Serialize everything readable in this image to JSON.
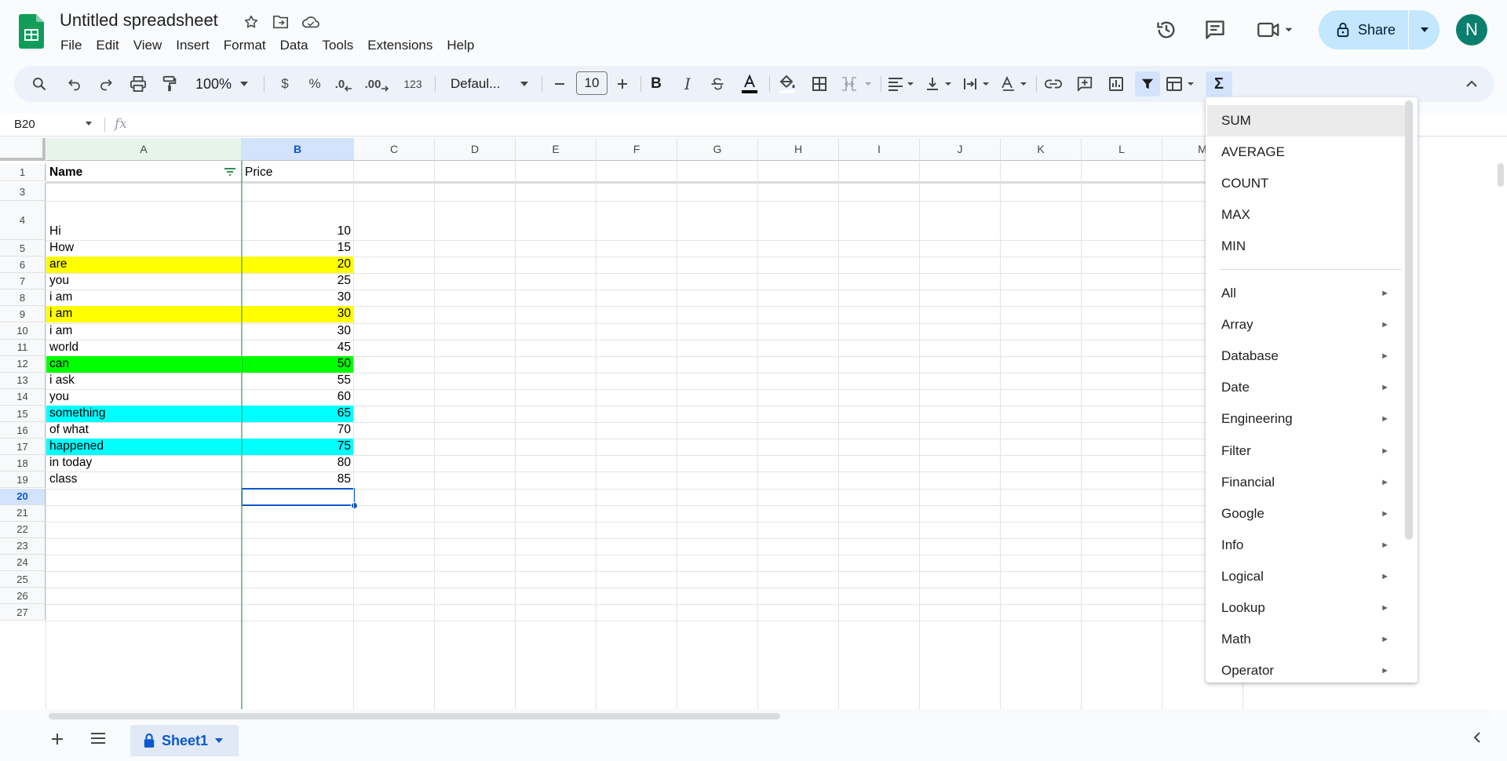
{
  "app": {
    "title": "Untitled spreadsheet",
    "menu": [
      "File",
      "Edit",
      "View",
      "Insert",
      "Format",
      "Data",
      "Tools",
      "Extensions",
      "Help"
    ],
    "share_label": "Share",
    "avatar_letter": "N",
    "accent": "#0b57d0",
    "share_bg": "#c2e7ff"
  },
  "toolbar": {
    "zoom": "100%",
    "currency": "$",
    "percent": "%",
    "dec_decrease": ".0",
    "dec_increase": ".00",
    "number_format": "123",
    "font": "Defaul...",
    "font_size": "10",
    "bold": "B",
    "italic": "I",
    "functions_symbol": "Σ"
  },
  "formula_bar": {
    "cell_ref": "B20",
    "fx": "fx"
  },
  "columns": [
    "A",
    "B",
    "C",
    "D",
    "E",
    "F",
    "G",
    "H",
    "I",
    "J",
    "K",
    "L",
    "M"
  ],
  "rows": [
    {
      "n": "1",
      "a": "Name",
      "b": "Price",
      "bold_a": true
    },
    {
      "n": "3",
      "a": "",
      "b": ""
    },
    {
      "n": "4",
      "a": "Hi",
      "b": "10"
    },
    {
      "n": "5",
      "a": "How",
      "b": "15"
    },
    {
      "n": "6",
      "a": "are",
      "b": "20",
      "fill": "#ffff00"
    },
    {
      "n": "7",
      "a": "you",
      "b": "25"
    },
    {
      "n": "8",
      "a": "i am",
      "b": "30"
    },
    {
      "n": "9",
      "a": "i am",
      "b": "30",
      "fill": "#ffff00"
    },
    {
      "n": "10",
      "a": "i am",
      "b": "30"
    },
    {
      "n": "11",
      "a": "world",
      "b": "45"
    },
    {
      "n": "12",
      "a": "can",
      "b": "50",
      "fill": "#00ff00"
    },
    {
      "n": "13",
      "a": "i ask",
      "b": "55"
    },
    {
      "n": "14",
      "a": "you",
      "b": "60"
    },
    {
      "n": "15",
      "a": "something",
      "b": "65",
      "fill": "#00ffff"
    },
    {
      "n": "16",
      "a": "of what",
      "b": "70"
    },
    {
      "n": "17",
      "a": "happened",
      "b": "75",
      "fill": "#00ffff"
    },
    {
      "n": "18",
      "a": "in today",
      "b": "80"
    },
    {
      "n": "19",
      "a": "class",
      "b": "85"
    },
    {
      "n": "20",
      "a": "",
      "b": ""
    },
    {
      "n": "21",
      "a": "",
      "b": ""
    },
    {
      "n": "22",
      "a": "",
      "b": ""
    },
    {
      "n": "23",
      "a": "",
      "b": ""
    },
    {
      "n": "24",
      "a": "",
      "b": ""
    },
    {
      "n": "25",
      "a": "",
      "b": ""
    },
    {
      "n": "26",
      "a": "",
      "b": ""
    },
    {
      "n": "27",
      "a": "",
      "b": ""
    }
  ],
  "sheet_tab": {
    "name": "Sheet1"
  },
  "function_menu": {
    "common": [
      "SUM",
      "AVERAGE",
      "COUNT",
      "MAX",
      "MIN"
    ],
    "categories": [
      "All",
      "Array",
      "Database",
      "Date",
      "Engineering",
      "Filter",
      "Financial",
      "Google",
      "Info",
      "Logical",
      "Lookup",
      "Math",
      "Operator"
    ],
    "submenu_arrow": "►"
  }
}
